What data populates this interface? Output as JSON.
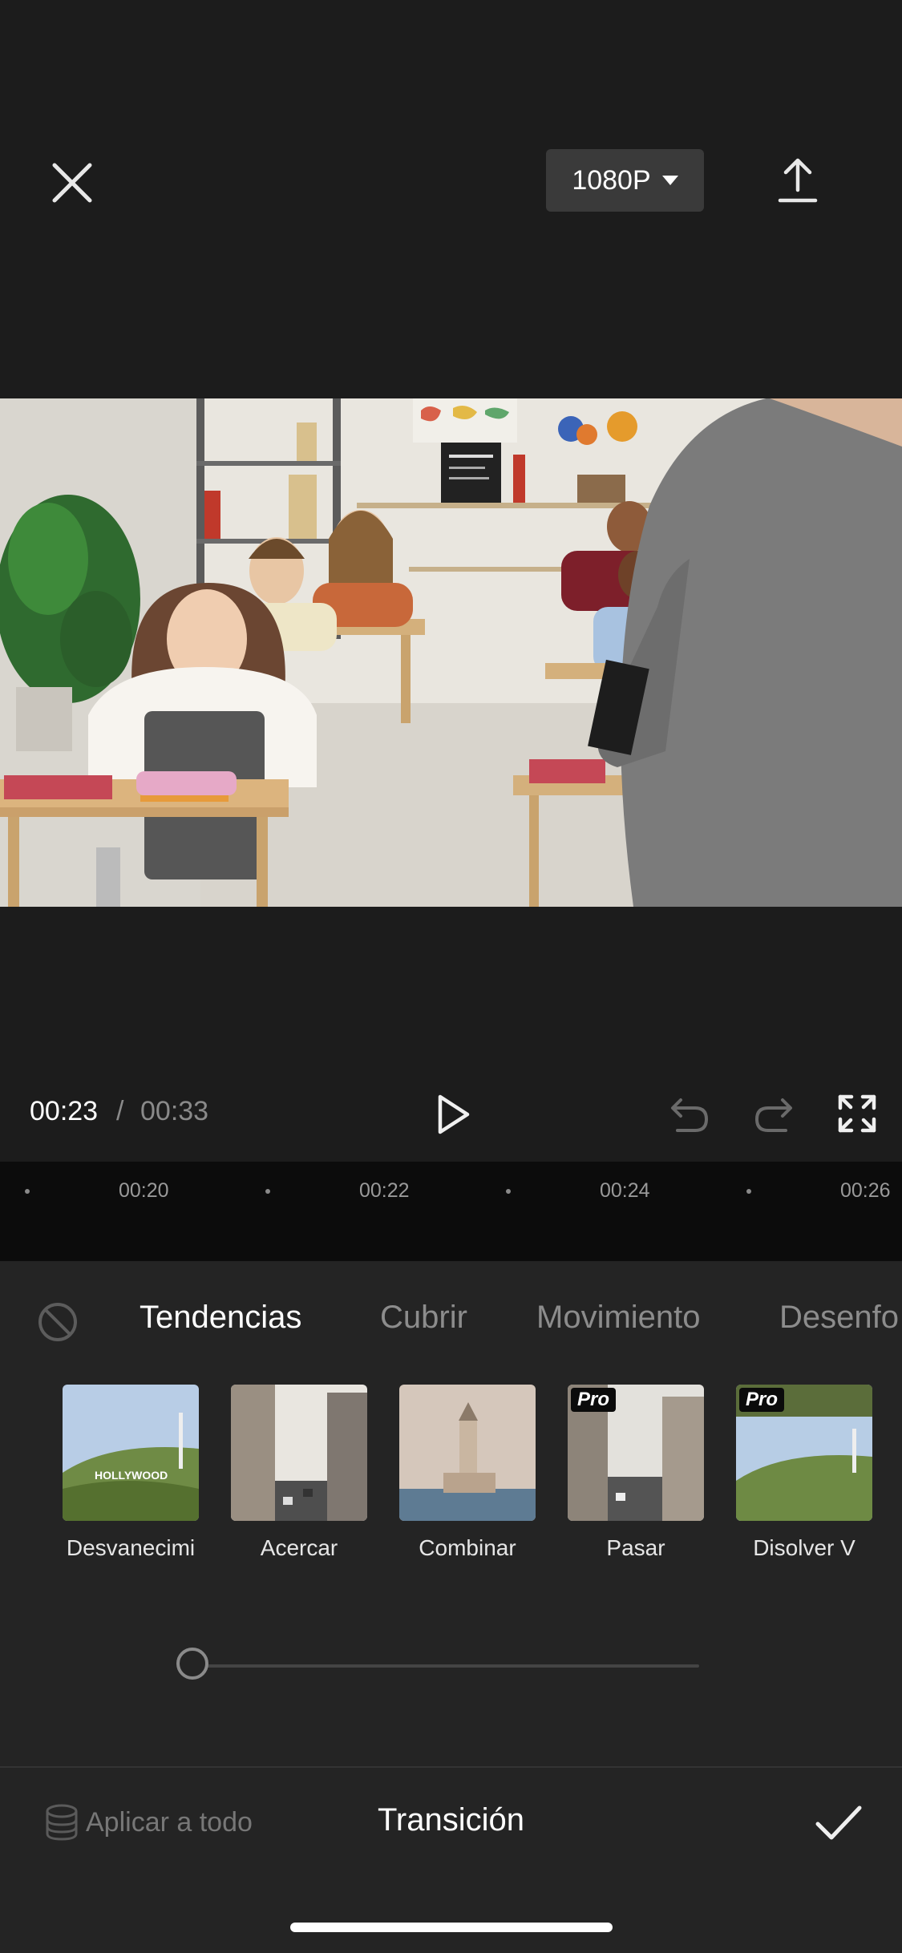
{
  "top_bar": {
    "close_icon": "close-icon",
    "resolution": "1080P",
    "export_icon": "upload-icon"
  },
  "player": {
    "current_time": "00:23",
    "separator": "/",
    "total_time": "00:33"
  },
  "ruler": {
    "ticks": [
      "00:20",
      "00:22",
      "00:24",
      "00:26"
    ]
  },
  "panel": {
    "tabs": [
      "Tendencias",
      "Cubrir",
      "Movimiento",
      "Desenfo"
    ],
    "active_tab": "Tendencias",
    "transitions": [
      {
        "label": "Desvanecimi",
        "pro": false
      },
      {
        "label": "Acercar",
        "pro": false
      },
      {
        "label": "Combinar",
        "pro": false
      },
      {
        "label": "Pasar",
        "pro": true
      },
      {
        "label": "Disolver V",
        "pro": true
      }
    ],
    "pro_badge": "Pro",
    "slider_value": 0,
    "apply_all": "Aplicar a todo",
    "title": "Transición"
  },
  "colors": {
    "background": "#1c1c1c",
    "panel": "#242424",
    "ruler": "#0c0c0c",
    "accent": "#ffffff"
  }
}
